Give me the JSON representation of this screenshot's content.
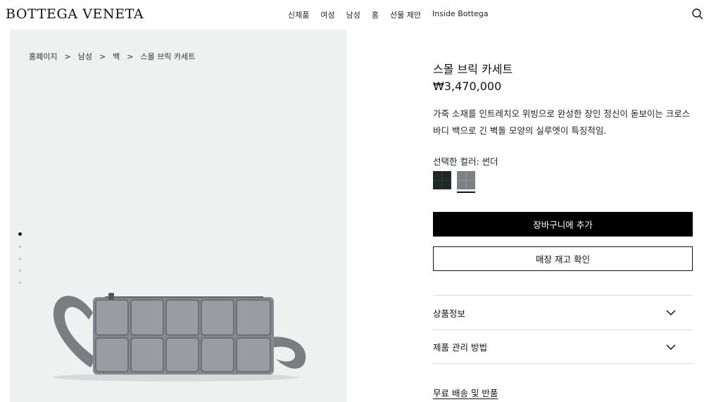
{
  "brand": "BOTTEGA VENETA",
  "nav": [
    "신제품",
    "여성",
    "남성",
    "홈",
    "선물 제안",
    "Inside Bottega"
  ],
  "breadcrumb": [
    "홈페이지",
    "남성",
    "백",
    "스몰 브릭 카세트"
  ],
  "product": {
    "title": "스몰 브릭 카세트",
    "price": "₩3,470,000",
    "description": "가죽 소재를 인트레치오 위빙으로 완성한 장인 정신이 돋보이는 크로스바디 백으로 긴 벽돌 모양의 실루엣이 특징적임.",
    "color_label": "선택한 컬러: 썬더",
    "swatches": [
      {
        "name": "dark-green",
        "color": "#1f2a26",
        "selected": false
      },
      {
        "name": "thunder",
        "color": "#7e8086",
        "selected": true
      }
    ],
    "add_to_cart": "장바구니에 추가",
    "check_store": "매장 재고 확인"
  },
  "accordions": [
    "상품정보",
    "제품 관리 방법"
  ],
  "shipping_link": "무료 배송 및 반품",
  "gallery": {
    "dot_count": 5,
    "active_dot": 0
  }
}
